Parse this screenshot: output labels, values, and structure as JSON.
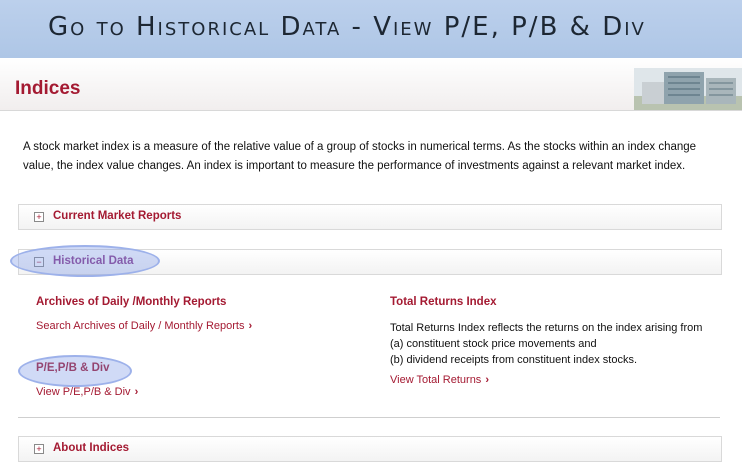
{
  "banner": {
    "text": "Go to Historical Data - View P/E, P/B & Div"
  },
  "header": {
    "title": "Indices"
  },
  "intro": "A stock market index is a measure of the relative value of a group of stocks in numerical terms. As the stocks within an index change value, the index value changes. An index is important to measure the performance of investments against a relevant market index.",
  "panels": {
    "current": {
      "toggle": "+",
      "label": "Current Market Reports"
    },
    "historical": {
      "toggle": "−",
      "label": "Historical Data"
    },
    "about": {
      "toggle": "+",
      "label": "About Indices"
    }
  },
  "historical": {
    "archives_heading": "Archives of Daily /Monthly Reports",
    "archives_link": "Search Archives of Daily / Monthly Reports",
    "pe_heading": "P/E,P/B & Div",
    "pe_link": "View P/E,P/B & Div",
    "tri_heading": "Total Returns Index",
    "tri_line1": "Total Returns Index reflects the returns on the index arising from",
    "tri_line2": "(a) constituent stock price movements and",
    "tri_line3": "(b) dividend receipts from constituent index stocks.",
    "tri_link": "View Total Returns",
    "chevron": "›"
  },
  "colors": {
    "accent": "#a41a32",
    "highlight": "#9db1ea",
    "banner": "#b3c9e8"
  }
}
